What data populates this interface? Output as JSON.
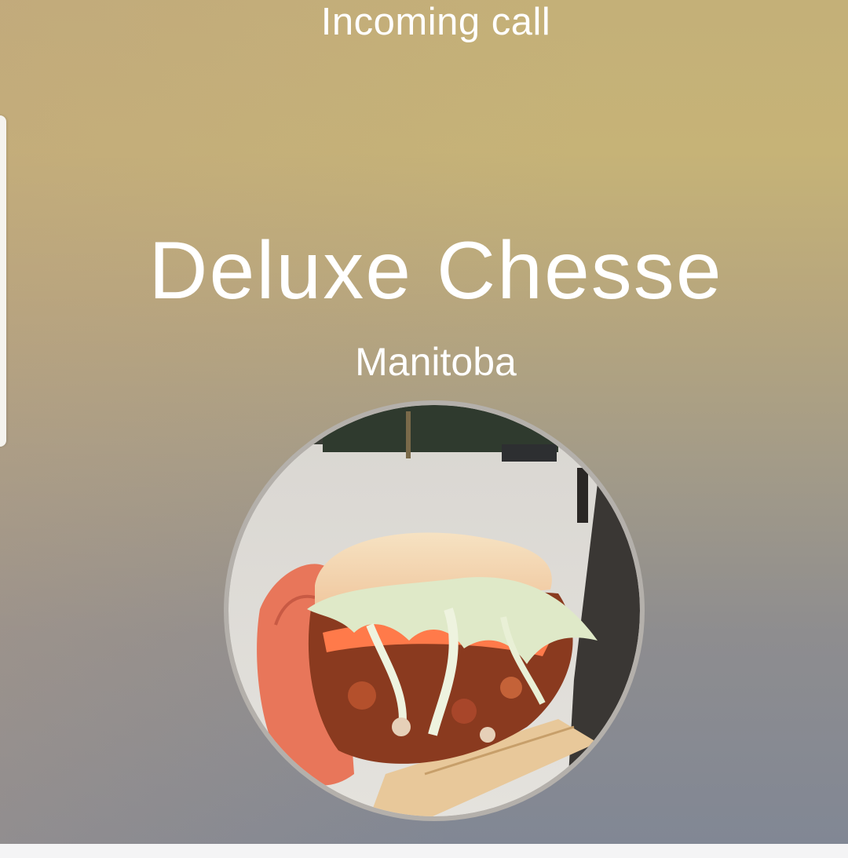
{
  "call": {
    "status_label": "Incoming call",
    "caller_name": "Deluxe Chesse",
    "caller_location": "Manitoba"
  },
  "avatar": {
    "description_icon": "caller-photo-burger"
  },
  "colors": {
    "text": "#ffffff",
    "bg_top": "#c4b078",
    "bg_bottom": "#818794",
    "avatar_ring": "#b4b0ab"
  }
}
